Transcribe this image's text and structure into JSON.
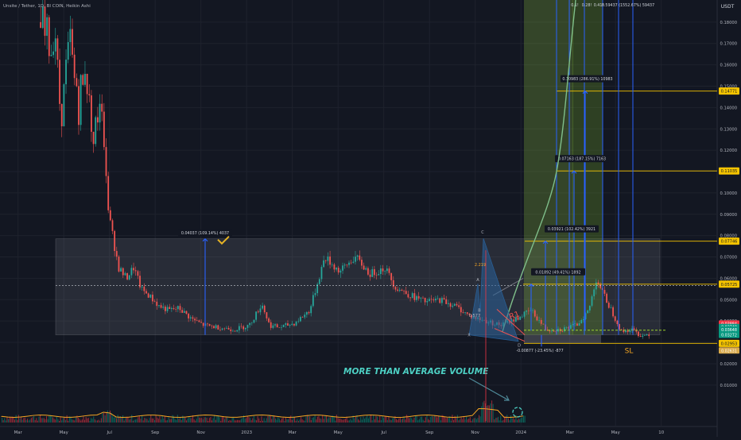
{
  "header": {
    "title": "Unsite / Tether, 1D, BI COIN, Heikin Ashi",
    "currency": "USDT"
  },
  "chart_data": {
    "type": "candlestick",
    "xlabel": "",
    "ylabel": "",
    "x_ticks": [
      "Mar",
      "May",
      "Jul",
      "Sep",
      "Nov",
      "2023",
      "Mar",
      "May",
      "Jul",
      "Sep",
      "Nov",
      "2024",
      "Mar",
      "May",
      "10"
    ],
    "y_ticks": [
      "0.18000",
      "0.17000",
      "0.16000",
      "0.15000",
      "0.14000",
      "0.13000",
      "0.12000",
      "0.11000",
      "0.10000",
      "0.09000",
      "0.08000",
      "0.07000",
      "0.06000",
      "0.05000",
      "0.04000",
      "0.03000",
      "0.02000",
      "0.01000"
    ],
    "y_range": [
      0.003,
      0.188
    ],
    "range_box": {
      "low": 0.0335,
      "high": 0.0785
    },
    "midline": 0.0567,
    "price_path": [
      [
        0.045,
        0.18
      ],
      [
        0.075,
        0.17
      ],
      [
        0.085,
        0.13
      ],
      [
        0.095,
        0.16
      ],
      [
        0.105,
        0.17
      ],
      [
        0.12,
        0.14
      ],
      [
        0.135,
        0.16
      ],
      [
        0.15,
        0.12
      ],
      [
        0.165,
        0.15
      ],
      [
        0.18,
        0.09
      ],
      [
        0.2,
        0.065
      ],
      [
        0.215,
        0.06
      ],
      [
        0.23,
        0.065
      ],
      [
        0.245,
        0.055
      ],
      [
        0.26,
        0.052
      ],
      [
        0.28,
        0.047
      ],
      [
        0.3,
        0.045
      ],
      [
        0.32,
        0.046
      ],
      [
        0.345,
        0.041
      ],
      [
        0.37,
        0.038
      ],
      [
        0.4,
        0.037
      ],
      [
        0.43,
        0.036
      ],
      [
        0.46,
        0.038
      ],
      [
        0.485,
        0.048
      ],
      [
        0.5,
        0.038
      ],
      [
        0.52,
        0.037
      ],
      [
        0.55,
        0.039
      ],
      [
        0.58,
        0.045
      ],
      [
        0.61,
        0.07
      ],
      [
        0.64,
        0.063
      ],
      [
        0.67,
        0.07
      ],
      [
        0.7,
        0.062
      ],
      [
        0.73,
        0.065
      ],
      [
        0.75,
        0.056
      ],
      [
        0.78,
        0.052
      ],
      [
        0.81,
        0.049
      ],
      [
        0.84,
        0.05
      ],
      [
        0.87,
        0.047
      ],
      [
        0.9,
        0.042
      ],
      [
        0.93,
        0.04
      ],
      [
        0.96,
        0.038
      ],
      [
        0.99,
        0.041
      ],
      [
        1.02,
        0.045
      ],
      [
        1.05,
        0.036
      ],
      [
        1.08,
        0.036
      ],
      [
        1.11,
        0.038
      ],
      [
        1.135,
        0.045
      ],
      [
        1.15,
        0.06
      ],
      [
        1.165,
        0.052
      ],
      [
        1.18,
        0.045
      ],
      [
        1.2,
        0.035
      ],
      [
        1.22,
        0.036
      ],
      [
        1.24,
        0.033
      ],
      [
        1.255,
        0.034
      ]
    ],
    "volume_band": true,
    "harmonic_labels": [
      "C",
      "A",
      "2.219",
      "B",
      "0.577",
      "X",
      "D"
    ],
    "pattern_label": "R1",
    "target_levels": [
      {
        "price": 0.05725,
        "label": "0.05725",
        "measure": "0.01892 (49.41%) 1892"
      },
      {
        "price": 0.0774,
        "label": "0.07746",
        "measure": "0.03921 (102.42%) 3921"
      },
      {
        "price": 0.1103,
        "label": "0.11035",
        "measure": "0.07163 (187.15%) 7163"
      },
      {
        "price": 0.1477,
        "label": "0.14771",
        "measure": "0.10983 (286.91%) 10983"
      }
    ],
    "top_measures": [
      "0.1!",
      "0.28!",
      "0.41!",
      "0.59437 (1552.67%) 59437"
    ],
    "stop_loss": {
      "price": 0.02953,
      "label": "0.02953",
      "text": "SL",
      "measure": "-0.00877 (-23.45%) -877"
    },
    "past_move": {
      "measure": "0.04037 (109.14%) 4037"
    },
    "price_tags": [
      {
        "price": 0.0388,
        "label": "0.03884",
        "color": "#f23645"
      },
      {
        "price": 0.0372,
        "label": "0.03748",
        "color": "#089981"
      },
      {
        "price": 0.036,
        "label": "0.03648",
        "color": "#089981"
      },
      {
        "price": 0.0335,
        "label": "0.03272",
        "color": "#089981"
      },
      {
        "price": 0.0262,
        "label": "0.02631",
        "color": "#d9a94a"
      }
    ],
    "annotation": "MORE THAN AVERAGE VOLUME"
  }
}
